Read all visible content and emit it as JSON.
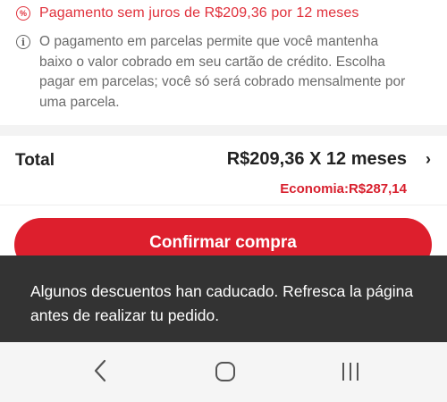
{
  "promo": {
    "icon": "discount-percent-icon",
    "text": "Pagamento sem juros de R$209,36 por 12 meses"
  },
  "info": {
    "icon": "info-icon",
    "text": "O pagamento em parcelas permite que você mantenha baixo o valor cobrado em seu cartão de crédito. Escolha pagar em parcelas; você só será cobrado mensalmente por uma parcela."
  },
  "summary": {
    "total_label": "Total",
    "total_value": "R$209,36 X 12 meses",
    "savings": "Economia:R$287,14"
  },
  "confirm_button": "Confirmar compra",
  "toast": {
    "message": "Algunos descuentos han caducado. Refresca la página antes de realizar tu pedido."
  },
  "navigation": {
    "back_icon": "back-icon",
    "home_icon": "home-icon",
    "recents_icon": "recent-apps-icon"
  },
  "colors": {
    "accent": "#dd1f2d",
    "toast_bg": "#333333",
    "navbar_bg": "#f5f5f5"
  }
}
